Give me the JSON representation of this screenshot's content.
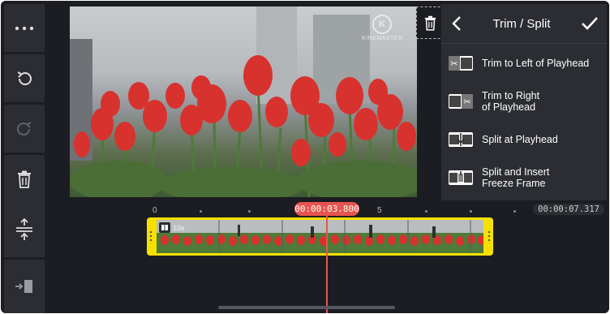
{
  "panel": {
    "title": "Trim / Split",
    "items": [
      {
        "label_line1": "Trim to Left of Playhead",
        "label_line2": ""
      },
      {
        "label_line1": "Trim to Right",
        "label_line2": "of Playhead"
      },
      {
        "label_line1": "Split at Playhead",
        "label_line2": ""
      },
      {
        "label_line1": "Split and Insert",
        "label_line2": "Freeze Frame"
      }
    ]
  },
  "preview": {
    "watermark": "KINEMASTER",
    "logo_letter": "K"
  },
  "timeline": {
    "current_time": "00:00:03.800",
    "end_time": "00:00:07.317",
    "ruler_labels": [
      "0",
      "5"
    ],
    "clip_badge": "10x"
  },
  "colors": {
    "accent_playhead": "#e8554e",
    "clip_border": "#f5e000",
    "panel_bg": "#2b2d33",
    "app_bg": "#1c1d22"
  },
  "icons": {
    "left_toolbar": [
      "more-icon",
      "undo-icon",
      "redo-icon",
      "trash-icon"
    ],
    "timeline_tools": [
      "vertical-expand-icon",
      "insert-clip-icon"
    ]
  }
}
